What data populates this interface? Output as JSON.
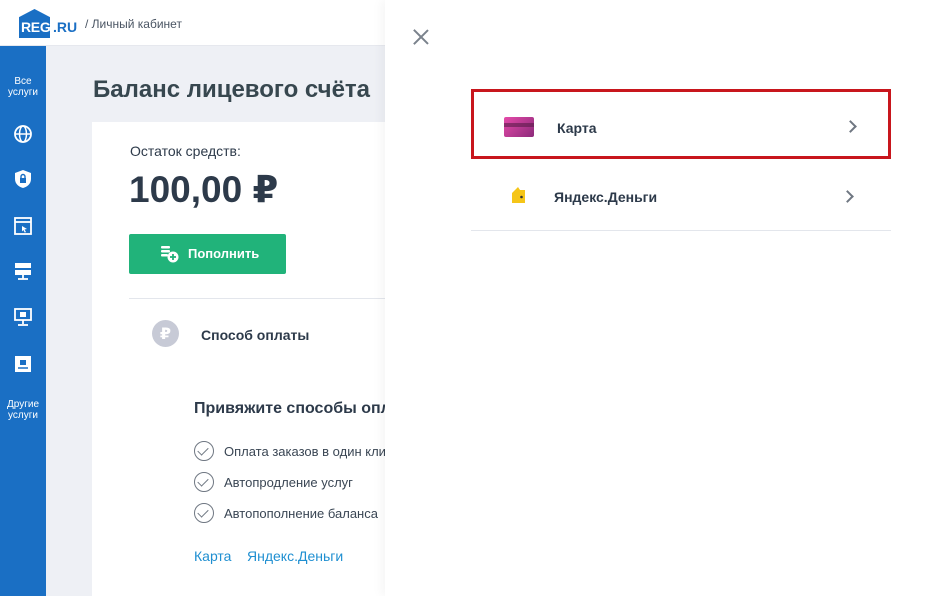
{
  "header": {
    "logo_main": "REG",
    "logo_suffix": ".RU",
    "breadcrumb": "/ Личный кабинет"
  },
  "sidebar": {
    "top_label_1": "Все",
    "top_label_2": "услуги",
    "icons": [
      "globe-icon",
      "lock-shield-icon",
      "browser-window-icon",
      "server-icon",
      "monitor-icon",
      "screen-icon"
    ],
    "bottom_label_1": "Другие",
    "bottom_label_2": "услуги"
  },
  "main": {
    "title": "Баланс лицевого счёта",
    "balance_label": "Остаток средств:",
    "balance_value": "100,00 ₽",
    "topup_label": "Пополнить",
    "payment_method_icon": "₽",
    "payment_method_label": "Способ оплаты",
    "bind_title": "Привяжите способы оплаты",
    "features": [
      "Оплата заказов в один клик",
      "Автопродление услуг",
      "Автопополнение баланса"
    ],
    "links": [
      "Карта",
      "Яндекс.Деньги"
    ]
  },
  "panel": {
    "options": [
      {
        "label": "Карта",
        "icon": "bank-card-icon"
      },
      {
        "label": "Яндекс.Деньги",
        "icon": "yandex-wallet-icon"
      }
    ],
    "highlight_color": "#c8161d"
  },
  "colors": {
    "brand": "#1a6fc4",
    "button": "#21b37a",
    "link": "#1f8fd1"
  }
}
